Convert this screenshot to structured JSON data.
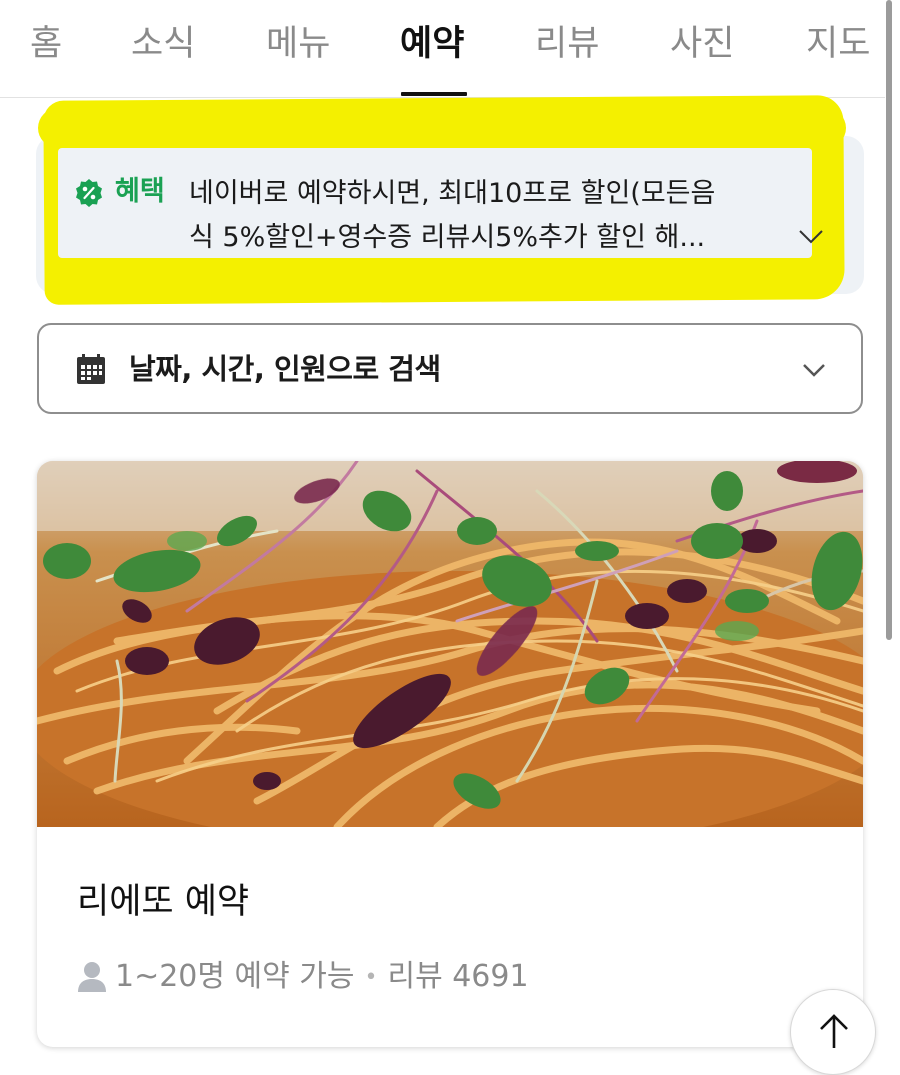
{
  "tabs": [
    {
      "label": "홈",
      "active": false
    },
    {
      "label": "소식",
      "active": false
    },
    {
      "label": "메뉴",
      "active": false
    },
    {
      "label": "예약",
      "active": true
    },
    {
      "label": "리뷰",
      "active": false
    },
    {
      "label": "사진",
      "active": false
    },
    {
      "label": "지도",
      "active": false
    }
  ],
  "benefit": {
    "icon": "percent-badge-icon",
    "label": "혜택",
    "line1": "네이버로 예약하시면, 최대10프로 할인(모든음",
    "line2": "식 5%할인+영수증 리뷰시5%추가 할인 해...",
    "highlight_color": "#f4f000",
    "accent_color": "#1aa153"
  },
  "search": {
    "icon": "calendar-icon",
    "label": "날짜, 시간, 인원으로 검색"
  },
  "card": {
    "image": "pasta-with-microgreens-photo",
    "title": "리에또 예약",
    "capacity": "1~20명 예약 가능",
    "separator": "•",
    "reviews": "리뷰 4691"
  },
  "scroll_top": {
    "icon": "arrow-up-icon"
  }
}
